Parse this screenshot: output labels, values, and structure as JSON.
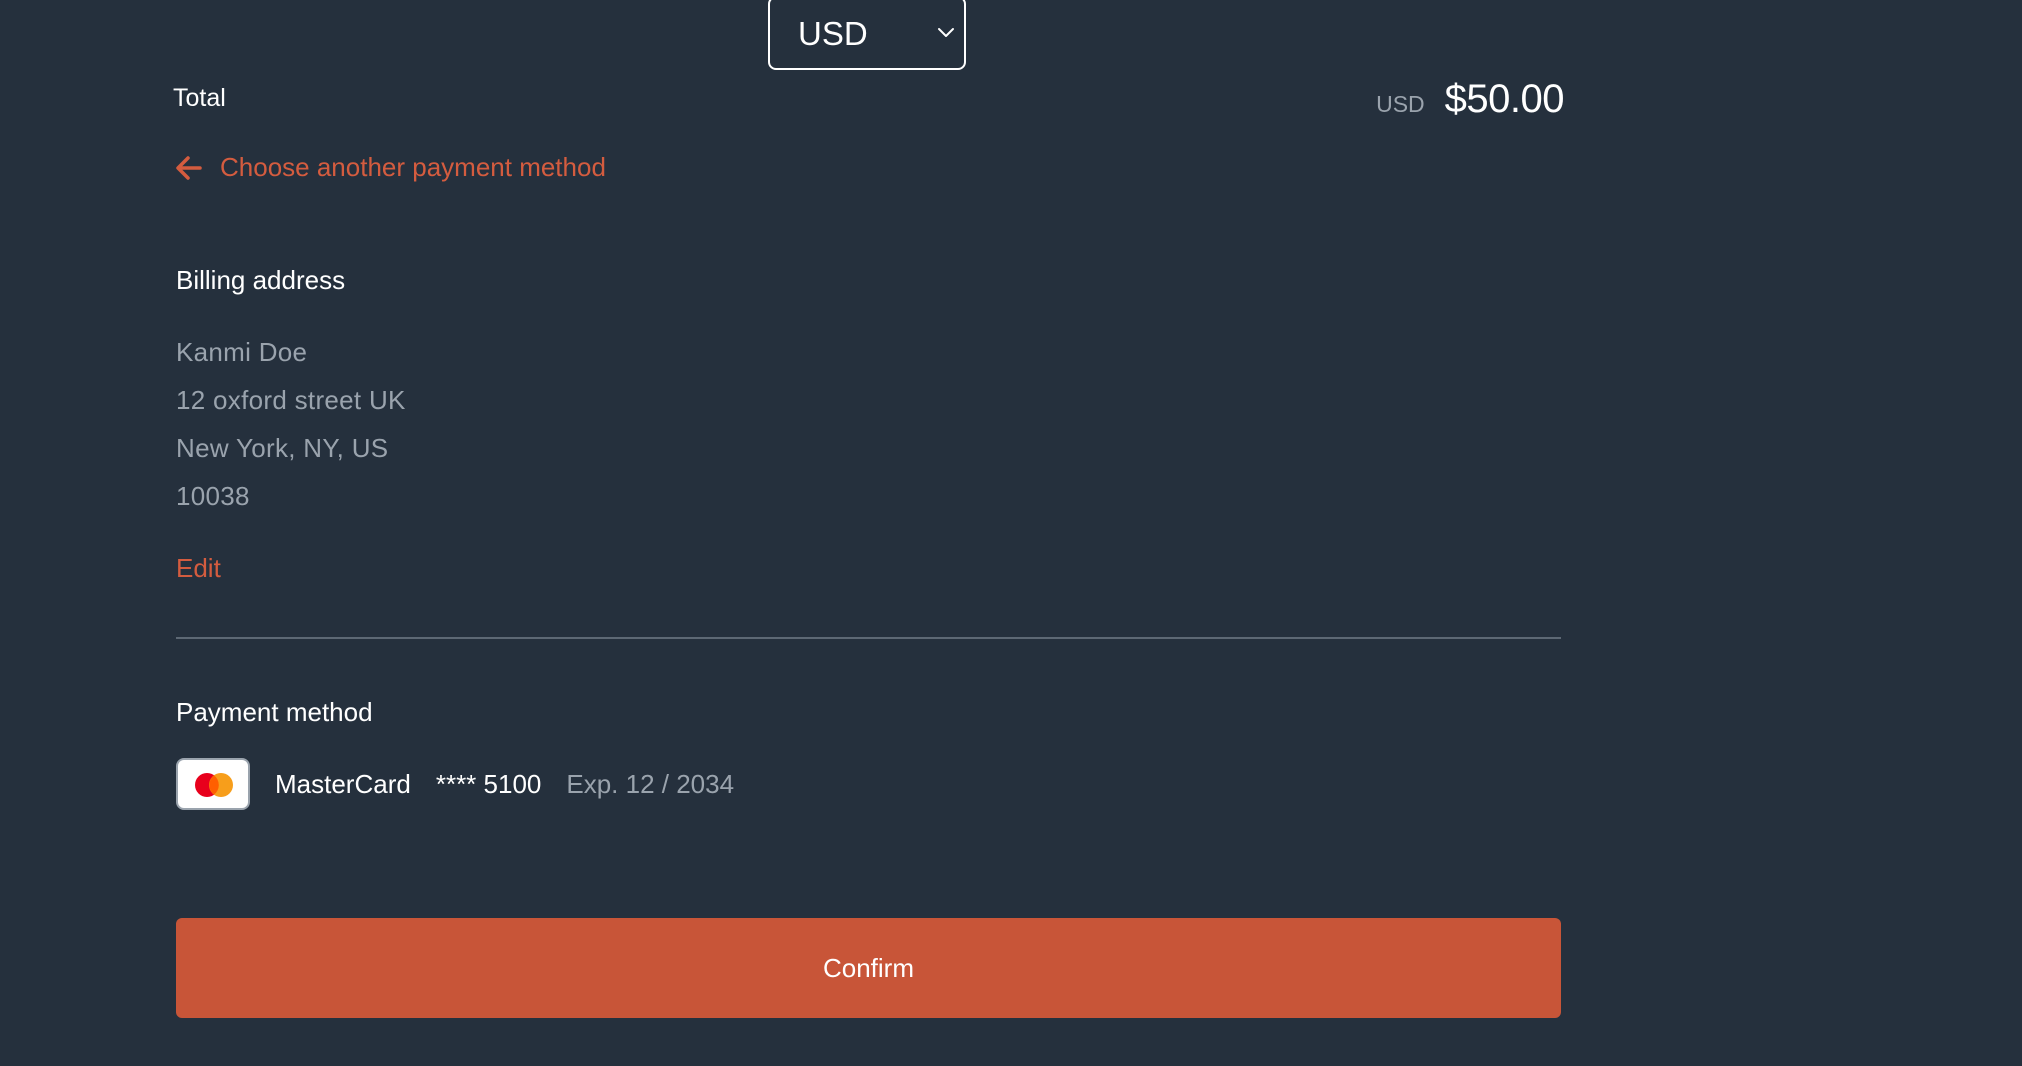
{
  "currency_select": {
    "value": "USD"
  },
  "summary": {
    "total_label": "Total",
    "currency_code": "USD",
    "amount": "$50.00"
  },
  "back_link": {
    "label": "Choose another payment method"
  },
  "billing": {
    "title": "Billing address",
    "lines": [
      "Kanmi Doe",
      "12 oxford street UK",
      "New York, NY, US",
      "10038"
    ],
    "edit_label": "Edit"
  },
  "payment": {
    "title": "Payment method",
    "card_brand": "MasterCard",
    "card_number": "**** 5100",
    "card_expiry": "Exp. 12 / 2034",
    "card_icon": "mastercard-logo"
  },
  "confirm_label": "Confirm",
  "colors": {
    "background": "#25303d",
    "accent": "#d45c3f",
    "button": "#c85538",
    "muted_text": "#9aa3ad"
  }
}
